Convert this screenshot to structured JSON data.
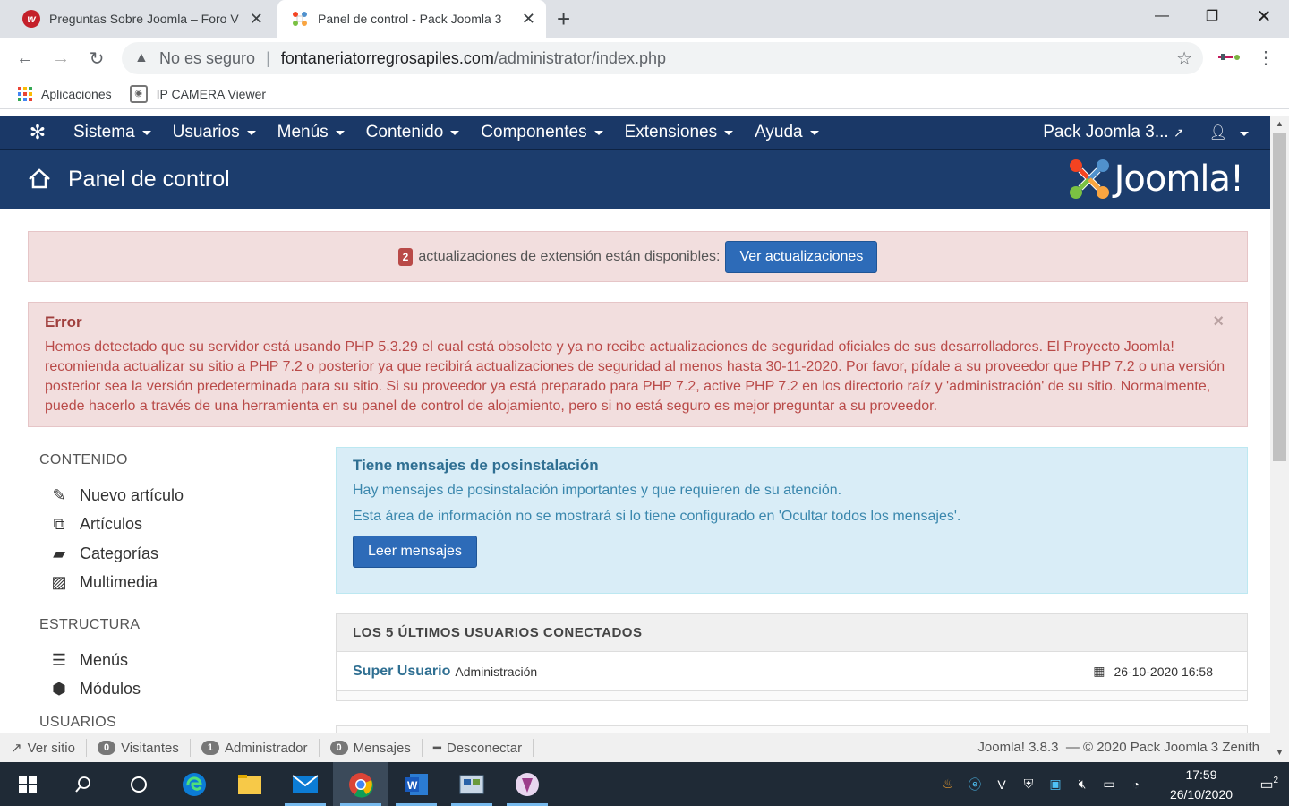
{
  "browser": {
    "tabs": [
      {
        "title": "Preguntas Sobre Joomla – Foro V",
        "active": false
      },
      {
        "title": "Panel de control - Pack Joomla 3",
        "active": true
      }
    ],
    "new_tab_symbol": "+",
    "address": {
      "security_label": "No es seguro",
      "host": "fontaneriatorregrosapiles.com",
      "path": "/administrator/index.php"
    },
    "bookmarks": [
      {
        "label": "Aplicaciones",
        "icon": "apps-grid-icon"
      },
      {
        "label": "IP CAMERA Viewer",
        "icon": "ip-camera-icon"
      }
    ]
  },
  "joomla": {
    "menu": [
      "Sistema",
      "Usuarios",
      "Menús",
      "Contenido",
      "Componentes",
      "Extensiones",
      "Ayuda"
    ],
    "site_name": "Pack Joomla 3...",
    "page_title": "Panel de control",
    "logo_text": "Joomla!",
    "updates": {
      "count": "2",
      "text": "actualizaciones de extensión están disponibles:",
      "button": "Ver actualizaciones"
    },
    "error": {
      "title": "Error",
      "close": "×",
      "message": "Hemos detectado que su servidor está usando PHP 5.3.29 el cual está obsoleto y ya no recibe actualizaciones de seguridad oficiales de sus desarrolladores. El Proyecto Joomla! recomienda actualizar su sitio a PHP 7.2 o posterior ya que recibirá actualizaciones de seguridad al menos hasta 30-11-2020. Por favor, pídale a su proveedor que PHP 7.2 o una versión posterior sea la versión predeterminada para su sitio. Si su proveedor ya está preparado para PHP 7.2, active PHP 7.2 en los directorio raíz y 'administración' de su sitio. Normalmente, puede hacerlo a través de una herramienta en su panel de control de alojamiento, pero si no está seguro es mejor preguntar a su proveedor."
    },
    "sidebar": {
      "content_head": "CONTENIDO",
      "content_items": [
        "Nuevo artículo",
        "Artículos",
        "Categorías",
        "Multimedia"
      ],
      "structure_head": "ESTRUCTURA",
      "structure_items": [
        "Menús",
        "Módulos"
      ],
      "users_head": "USUARIOS"
    },
    "postinstall": {
      "title": "Tiene mensajes de posinstalación",
      "text1": "Hay mensajes de posinstalación importantes y que requieren de su atención.",
      "text2": "Esta área de información no se mostrará si lo tiene configurado en 'Ocultar todos los mensajes'.",
      "button": "Leer mensajes"
    },
    "last_users": {
      "title": "LOS 5 ÚLTIMOS USUARIOS CONECTADOS",
      "rows": [
        {
          "name": "Super Usuario",
          "role": "Administración",
          "date": "26-10-2020 16:58"
        }
      ]
    },
    "statusbar": {
      "view_site": "Ver sitio",
      "visitors_count": "0",
      "visitors": "Visitantes",
      "admins_count": "1",
      "admins": "Administrador",
      "messages_count": "0",
      "messages": "Mensajes",
      "logout": "Desconectar",
      "version": "Joomla! 3.8.3",
      "copyright": "— © 2020 Pack Joomla 3 Zenith"
    }
  },
  "taskbar": {
    "clock_time": "17:59",
    "clock_date": "26/10/2020",
    "notification_count": "2"
  },
  "colors": {
    "joomla_nav": "#1a3867",
    "joomla_header": "#1c3d6d",
    "primary_button": "#2d6bb8",
    "error_bg": "#f2dede",
    "info_bg": "#d9edf7"
  }
}
